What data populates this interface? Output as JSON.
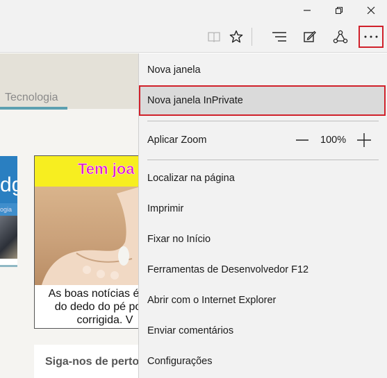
{
  "window": {
    "controls": {
      "minimize": "minimize-icon",
      "restore": "restore-icon",
      "close": "close-icon"
    }
  },
  "toolbar": {
    "icons": [
      "reading-view-icon",
      "favorite-star-icon",
      "hub-icon",
      "web-note-icon",
      "share-icon",
      "more-icon"
    ],
    "highlight_color": "#d0202a"
  },
  "page": {
    "nav_tab": "Tecnologia",
    "left_card_big": "dge",
    "left_card_small": "ogia",
    "ad_title": "Tem joa",
    "ad_text_lines": [
      "As boas notícias é",
      "do dedo do pé po",
      "corrigida. V"
    ],
    "follow_text": "Siga-nos de perto"
  },
  "menu": {
    "items": [
      {
        "label": "Nova janela"
      },
      {
        "label": "Nova janela InPrivate",
        "highlighted": true
      },
      {
        "label": "Aplicar Zoom",
        "zoom": {
          "value": "100%",
          "minus": "zoom-out-icon",
          "plus": "zoom-in-icon"
        }
      },
      {
        "label": "Localizar na página"
      },
      {
        "label": "Imprimir"
      },
      {
        "label": "Fixar no Início"
      },
      {
        "label": "Ferramentas de Desenvolvedor F12"
      },
      {
        "label": "Abrir com o Internet Explorer"
      },
      {
        "label": "Enviar comentários"
      },
      {
        "label": "Configurações"
      }
    ]
  }
}
